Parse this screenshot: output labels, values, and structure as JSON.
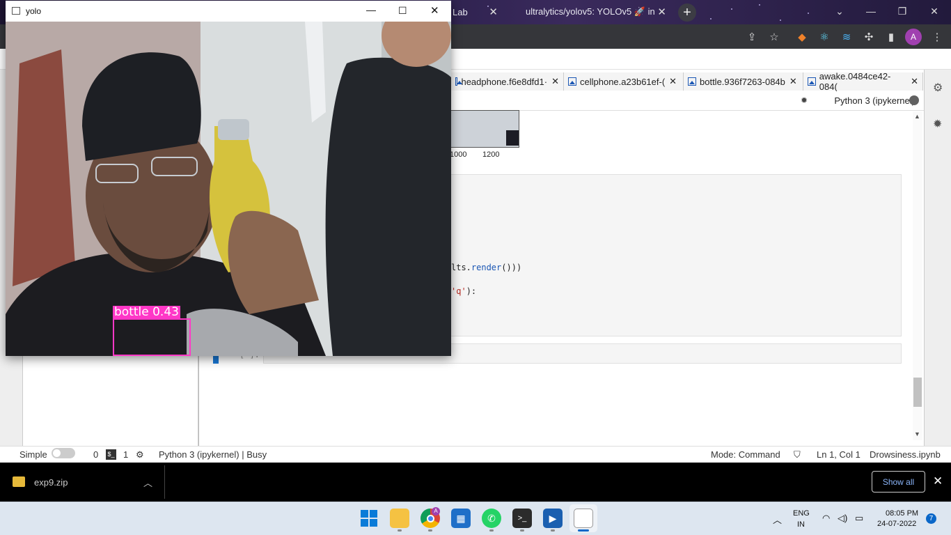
{
  "browser": {
    "tabs": [
      {
        "label": "Lab"
      },
      {
        "label": "ultralytics/yolov5: YOLOv5 🚀 in"
      }
    ],
    "new_tab": "+",
    "profile_initial": "A"
  },
  "jupyter": {
    "doc_tabs": [
      {
        "label": "headphone.f6e8dfd1·"
      },
      {
        "label": "cellphone.a23b61ef-("
      },
      {
        "label": "bottle.936f7263-084b"
      },
      {
        "label": "awake.0484ce42-084("
      }
    ],
    "kernel": "Python 3 (ipykernel)",
    "plot_ticks": [
      "1000",
      "1200"
    ],
    "code_lines": [
      {
        "prefix": "lts.",
        "func": "render",
        "suffix": "()))"
      },
      {
        "prefix": "'q'",
        "func": "",
        "suffix": "):"
      }
    ],
    "empty_prompt": "[ ]:"
  },
  "statusbar": {
    "mode_label": "Simple",
    "terminals": "0",
    "kernels": "1",
    "kernel_status": "Python 3 (ipykernel) | Busy",
    "mode": "Mode: Command",
    "cursor": "Ln 1, Col 1",
    "file": "Drowsiness.ipynb"
  },
  "downloads": {
    "file": "exp9.zip",
    "show_all": "Show all"
  },
  "taskbar": {
    "lang_top": "ENG",
    "lang_bottom": "IN",
    "time": "08:05 PM",
    "date": "24-07-2022",
    "notifications": "7"
  },
  "yolo_window": {
    "title": "yolo",
    "detection_label": "bottle  0.43",
    "detection_class": "bottle",
    "detection_confidence": 0.43
  },
  "colors": {
    "bbox": "#ff37c7",
    "kernel_idle": "#616161",
    "accent": "#1976d2"
  }
}
